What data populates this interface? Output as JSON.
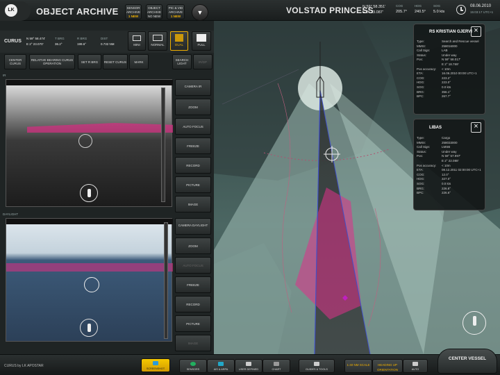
{
  "header": {
    "logo": "LK",
    "title": "OBJECT ARCHIVE",
    "archive_buttons": [
      {
        "line1": "SENSOR",
        "line2": "ARCHIVE",
        "badge": "1 NEW"
      },
      {
        "line1": "OBJECT",
        "line2": "ARCHIVE",
        "badge": "NO NEW"
      },
      {
        "line1": "PIC & VID",
        "line2": "ARCHIVE",
        "badge": "1 NEW"
      }
    ],
    "vessel_name": "VOLSTAD PRINCESS",
    "position_n": "N 59° 58.351'",
    "position_e": "E 2° 23.087'",
    "cog_label": "COG",
    "cog_value": "205.7°",
    "hdg_label": "HDG",
    "hdg_value": "240.5°",
    "sog_label": "SOG",
    "sog_value": "5.0 kts",
    "date": "08.06.2010",
    "time": "15:03:17 UTC+1"
  },
  "camera_panel": {
    "sensor_name": "CURUS",
    "position_n": "N 59° 58.474'",
    "position_e": "E 2° 23.070'",
    "tbrg_label": "T BRG",
    "tbrg_value": "36.2°",
    "rbrg_label": "R BRG",
    "rbrg_value": "199.6°",
    "dist_label": "DIST",
    "dist_value": "0.732 NM",
    "view_modes": [
      {
        "label": "MINI",
        "active": false
      },
      {
        "label": "NORMAL",
        "active": false
      },
      {
        "label": "DUAL",
        "active": true
      },
      {
        "label": "FULL",
        "active": false
      }
    ],
    "toolbar": [
      {
        "label": "CENTER CURUS"
      },
      {
        "label": "RELATIVE BEARING CURUS OPERATION"
      },
      {
        "label": "SET R BRG"
      },
      {
        "label": "RESET CURUS"
      },
      {
        "label": "MARK"
      },
      {
        "label": "SEARCH LIGHT"
      },
      {
        "label": "IR/DP"
      }
    ],
    "ir_label": "IR",
    "daylight_label": "DAYLIGHT",
    "ir_buttons": [
      {
        "label": "CAMERA IR"
      },
      {
        "label": "ZOOM"
      },
      {
        "label": "AUTO FOCUS"
      },
      {
        "label": "FREEZE"
      },
      {
        "label": "RECORD"
      },
      {
        "label": "PICTURE"
      },
      {
        "label": "IMAGE"
      }
    ],
    "daylight_buttons": [
      {
        "label": "CAMERA DAYLIGHT"
      },
      {
        "label": "ZOOM"
      },
      {
        "label": "AUTO FOCUS"
      },
      {
        "label": "FREEZE"
      },
      {
        "label": "RECORD"
      },
      {
        "label": "PICTURE"
      },
      {
        "label": "IMAGE"
      }
    ]
  },
  "card1": {
    "title": "RS KRISTIAN GJERVI",
    "rows": [
      [
        "Type:",
        "Search and Rescue vessel"
      ],
      [
        "MMSI:",
        "258016000"
      ],
      [
        "Call Sign:",
        "LAB"
      ],
      [
        "Status:",
        "Under way"
      ],
      [
        "Pos:",
        "N 59° 58.017'"
      ],
      [
        "",
        "E 2° 18.769'"
      ],
      [
        "Pos accuracy:",
        "< 10m"
      ],
      [
        "ETA:",
        "16.06.2010 00:00 UTC+1"
      ],
      [
        "COG:",
        "223.2°"
      ],
      [
        "HDG:",
        "223.0°"
      ],
      [
        "SOG:",
        "0.0 kts"
      ],
      [
        "BRG:",
        "356.1°"
      ],
      [
        "BPC:",
        "267.7°"
      ]
    ]
  },
  "card2": {
    "title": "LIBAS",
    "rows": [
      [
        "Type:",
        "Cargo"
      ],
      [
        "MMSI:",
        "258033000"
      ],
      [
        "Call Sign:",
        "LMSB"
      ],
      [
        "Status:",
        "Under way"
      ],
      [
        "Pos:",
        "N 59° 57.997'"
      ],
      [
        "",
        "E 2° 22.088'"
      ],
      [
        "Pos accuracy:",
        "< 10m"
      ],
      [
        "ETA:",
        "08.12.2011 02:00:00 UTC+1"
      ],
      [
        "COG:",
        "12.0°"
      ],
      [
        "HDG:",
        "327.0°"
      ],
      [
        "SOG:",
        "0.0 kts"
      ],
      [
        "BRG:",
        "226.8°"
      ],
      [
        "BPC:",
        "226.6°"
      ]
    ]
  },
  "footer": {
    "brand": "CURUS by LK APOSTAR",
    "buttons": [
      {
        "label": "SCREENSHOT",
        "active": true,
        "color": "#2e9bd6"
      },
      {
        "label": "SENSORS",
        "color": "#22b060"
      },
      {
        "label": "AIS & ARPA",
        "color": "#22a8c8"
      },
      {
        "label": "USER DEFINED",
        "color": "#cccccc"
      },
      {
        "label": "CHART",
        "color": "#999999"
      },
      {
        "label": "GUIDES & TOOLS",
        "color": "#cccccc"
      },
      {
        "label": "1:40 NM SCALE",
        "color": "#f0b000"
      },
      {
        "label": "HEADING UP ORIENTATION",
        "color": "#f0b000"
      },
      {
        "label": "AUTO",
        "color": "#cccccc"
      }
    ],
    "center_vessel": "CENTER VESSEL"
  },
  "colors": {
    "accent_yellow": "#f0b000",
    "overlay_magenta": "#e0308a",
    "panel": "#1f2424"
  }
}
